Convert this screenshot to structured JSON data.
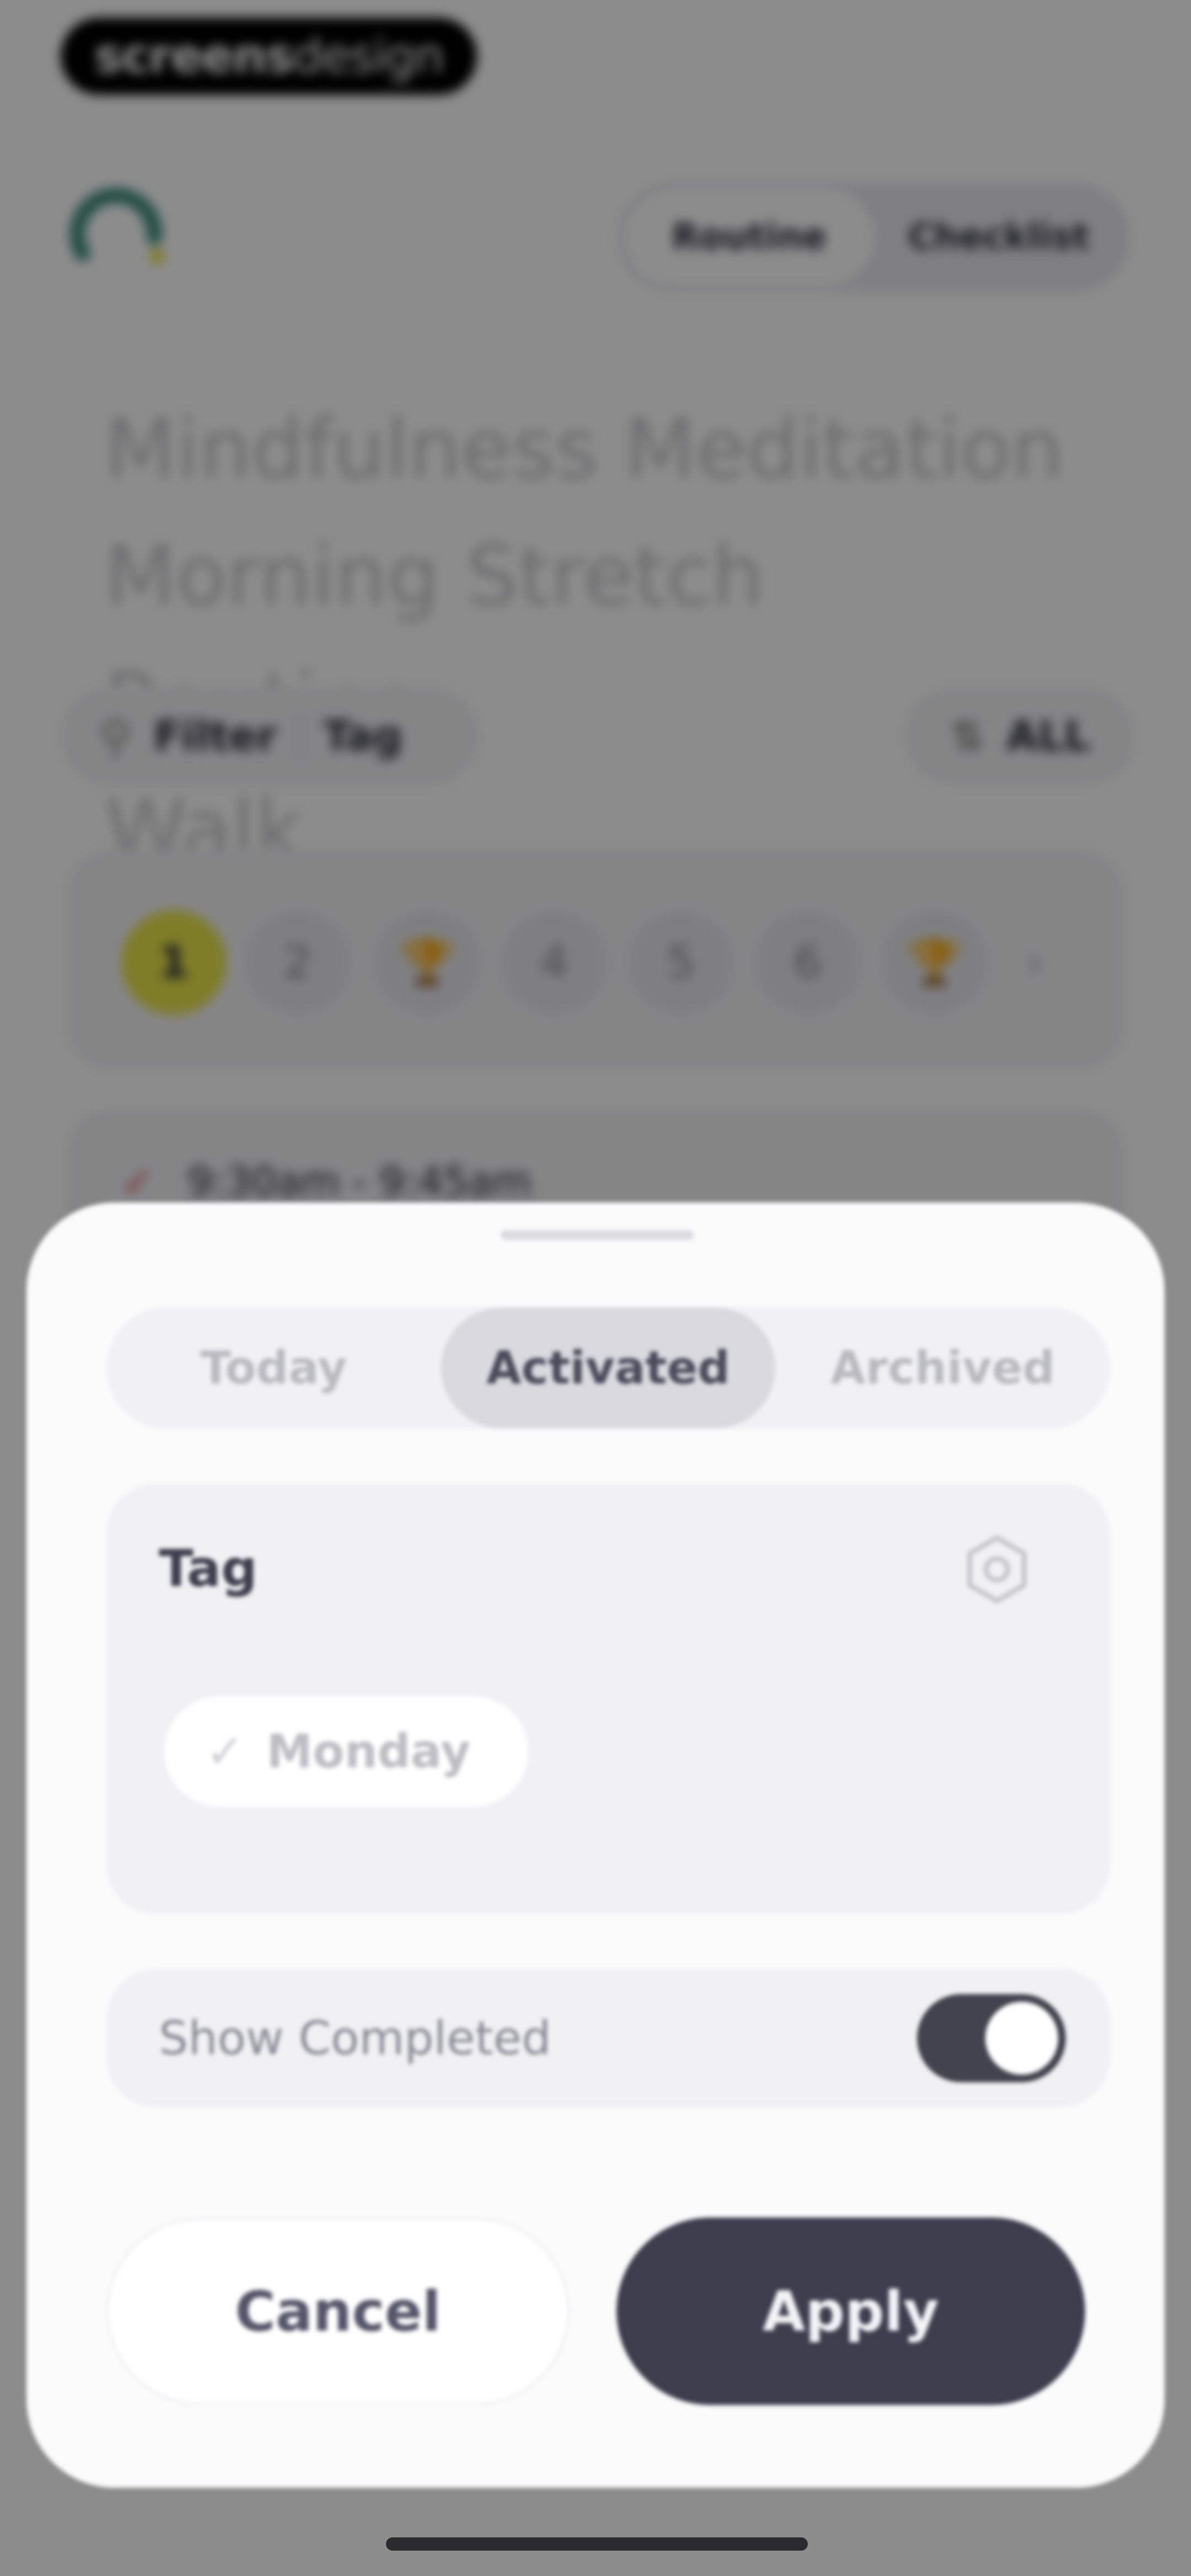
{
  "watermark": {
    "bold": "screens",
    "light": "design"
  },
  "header": {
    "segments": [
      {
        "label": "Routine",
        "active": true
      },
      {
        "label": "Checklist",
        "active": false
      }
    ]
  },
  "background": {
    "headline_lines": [
      "Mindfulness Meditation",
      "Morning Stretch Routine",
      "Walk"
    ],
    "filter": {
      "filter_label": "Filter",
      "tag_label": "Tag"
    },
    "sort": {
      "label": "ALL"
    },
    "steps": [
      "1",
      "2",
      "🏆",
      "4",
      "5",
      "6",
      "🏆"
    ],
    "current_step": "1",
    "time": "9:30am - 9:45am"
  },
  "sheet": {
    "tabs": [
      {
        "label": "Today",
        "active": false
      },
      {
        "label": "Activated",
        "active": true
      },
      {
        "label": "Archived",
        "active": false
      }
    ],
    "tag_section": {
      "title": "Tag",
      "chips": [
        {
          "label": "Monday",
          "selected": false
        }
      ]
    },
    "show_completed": {
      "label": "Show Completed",
      "on": true
    },
    "cancel_label": "Cancel",
    "apply_label": "Apply"
  },
  "colors": {
    "accent_dark": "#3d3d4e",
    "step_current": "#e8e44a",
    "sheet_bg": "#fbfbfc"
  }
}
